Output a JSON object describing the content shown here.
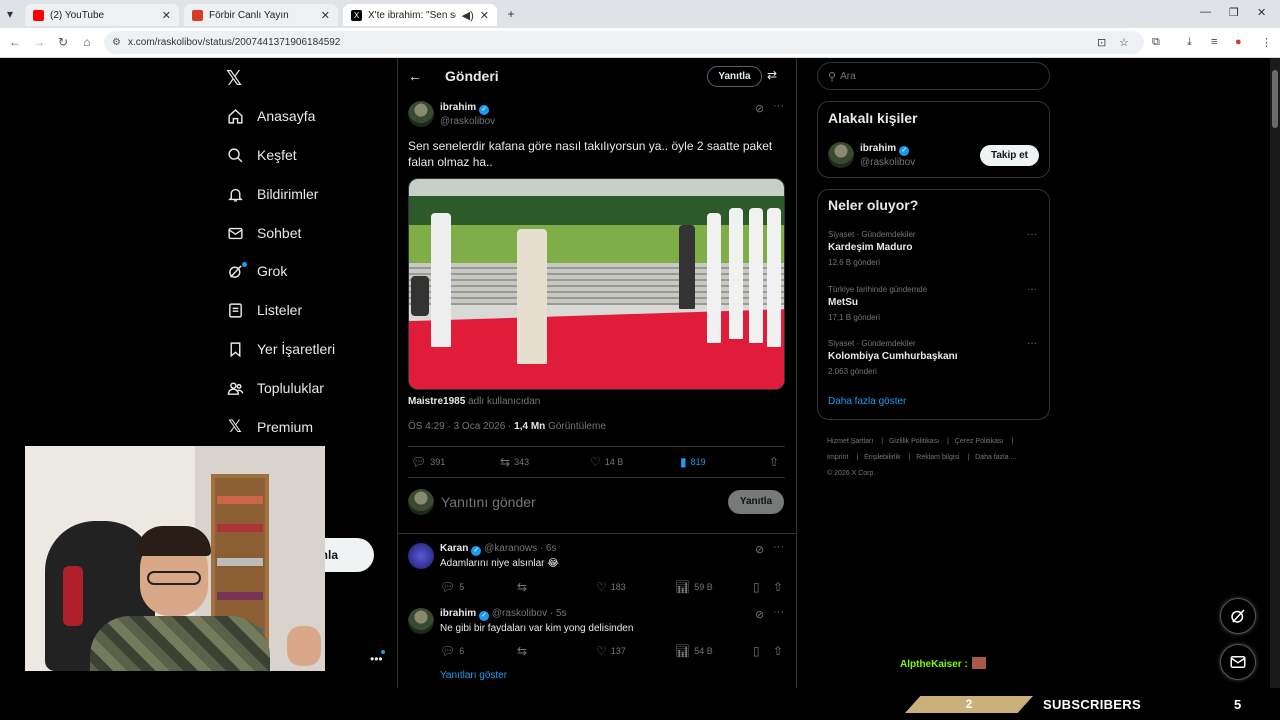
{
  "browser": {
    "tabs": [
      {
        "label": "(2) YouTube",
        "favicon_color": "#ff0000"
      },
      {
        "label": "Förbir Canlı Yayın",
        "favicon_color": "#d83b2a"
      },
      {
        "label": "X'te ibrahim: \"Sen senelerdi",
        "favicon_color": "#000000"
      }
    ],
    "url": "x.com/raskolibov/status/2007441371906184592"
  },
  "nav": {
    "items": [
      {
        "label": "Anasayfa",
        "icon": "home-icon"
      },
      {
        "label": "Keşfet",
        "icon": "search-icon"
      },
      {
        "label": "Bildirimler",
        "icon": "bell-icon"
      },
      {
        "label": "Sohbet",
        "icon": "mail-icon"
      },
      {
        "label": "Grok",
        "icon": "grok-icon"
      },
      {
        "label": "Listeler",
        "icon": "list-icon"
      },
      {
        "label": "Yer İşaretleri",
        "icon": "bookmark-icon"
      },
      {
        "label": "Topluluklar",
        "icon": "people-icon"
      },
      {
        "label": "Premium",
        "icon": "x-logo-icon"
      }
    ],
    "post_button_partial": "nla"
  },
  "header": {
    "title": "Gönderi",
    "reply_button": "Yanıtla"
  },
  "tweet": {
    "name": "ibrahim",
    "handle": "@raskolibov",
    "text": "Sen senelerdir kafana göre nasıl takılıyorsun ya.. öyle 2 saatte paket falan olmaz ha..",
    "credit_user": "Maistre1985",
    "credit_suffix": "adlı kullanıcıdan",
    "time": "ÖS 4:29 · 3 Oca 2026 · ",
    "views": "1,4 Mn",
    "views_label": "Görüntüleme",
    "replies": "391",
    "retweets": "343",
    "likes": "14 B",
    "bookmarks": "819"
  },
  "compose": {
    "placeholder": "Yanıtını gönder",
    "button": "Yanıtla"
  },
  "replies": [
    {
      "name": "Karan",
      "handle": "@karanows · 6s",
      "text": "Adamlarını niye alsınlar 😂",
      "replies": "5",
      "likes": "183",
      "views": "59 B"
    },
    {
      "name": "ibrahim",
      "handle": "@raskolibov · 5s",
      "text": "Ne gibi bir faydaları var kim yong delisinden",
      "replies": "6",
      "likes": "137",
      "views": "54 B"
    }
  ],
  "show_replies": "Yanıtları göster",
  "sidebar": {
    "search_placeholder": "Ara",
    "relevant_title": "Alakalı kişiler",
    "relevant_name": "ibrahim",
    "relevant_handle": "@raskolibov",
    "follow_button": "Takip et",
    "trends_title": "Neler oluyor?",
    "trends": [
      {
        "category": "Siyaset · Gündemdekiler",
        "name": "Kardeşim Maduro",
        "count": "12,6 B gönderi"
      },
      {
        "category": "Türkiye tarihinde gündemde",
        "name": "MetSu",
        "count": "17,1 B gönderi"
      },
      {
        "category": "Siyaset · Gündemdekiler",
        "name": "Kolombiya Cumhurbaşkanı",
        "count": "2.063 gönderi"
      }
    ],
    "show_more": "Daha fazla göster",
    "footer": [
      "Hizmet Şartları",
      "Gizlilik Politikası",
      "Çerez Politikası",
      "Imprint",
      "Erişilebilirlik",
      "Reklam bilgisi",
      "Daha fazla ...",
      "© 2026 X Corp."
    ]
  },
  "stream": {
    "chat_user": "AlptheKaiser :",
    "sub_count": "2",
    "sub_label": "SUBSCRIBERS",
    "sub_goal": "5"
  }
}
